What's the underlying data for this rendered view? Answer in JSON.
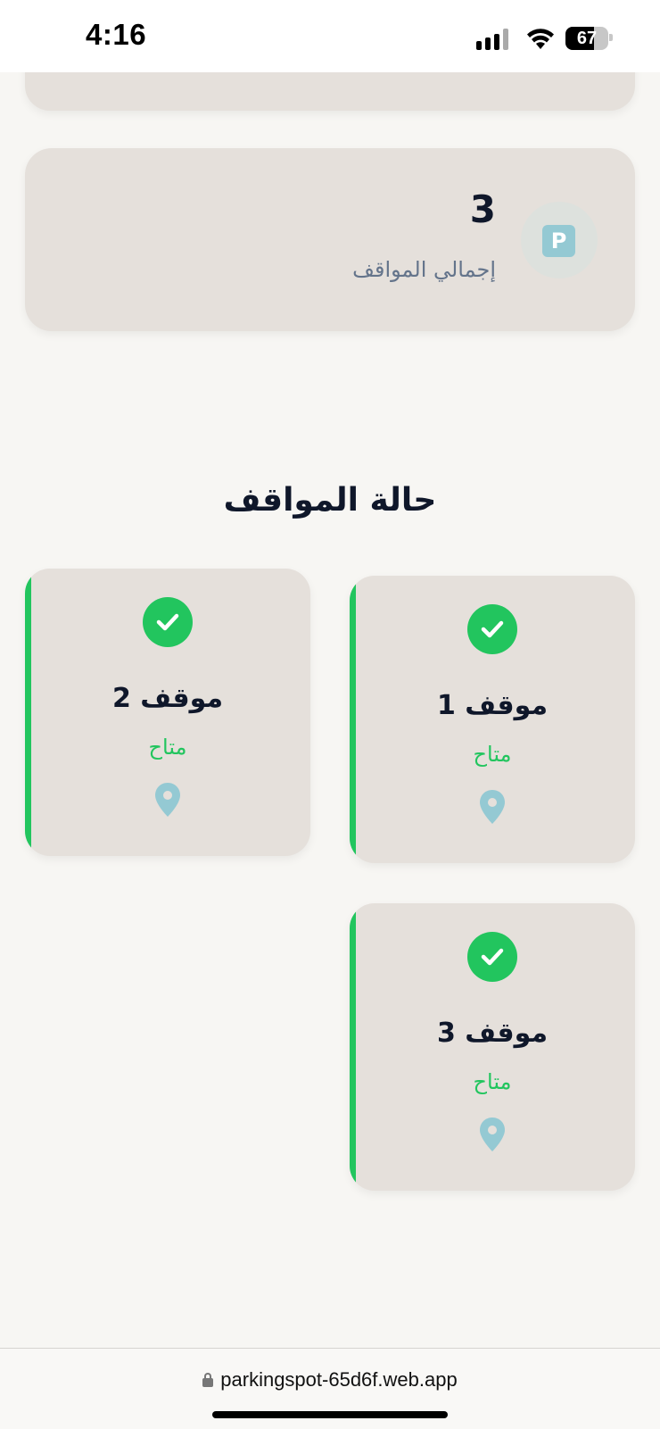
{
  "status_bar": {
    "time": "4:16",
    "battery": "67",
    "battery_level": 0.67
  },
  "total_card": {
    "value": "3",
    "label": "إجمالي المواقف",
    "icon_letter": "P"
  },
  "section": {
    "title": "حالة المواقف"
  },
  "spots": [
    {
      "name": "موقف 1",
      "status": "متاح"
    },
    {
      "name": "موقف 2",
      "status": "متاح"
    },
    {
      "name": "موقف 3",
      "status": "متاح"
    }
  ],
  "colors": {
    "accent": "#22c55e",
    "card": "#e5e0db",
    "pin": "#94c9d3"
  },
  "browser": {
    "url": "parkingspot-65d6f.web.app"
  }
}
